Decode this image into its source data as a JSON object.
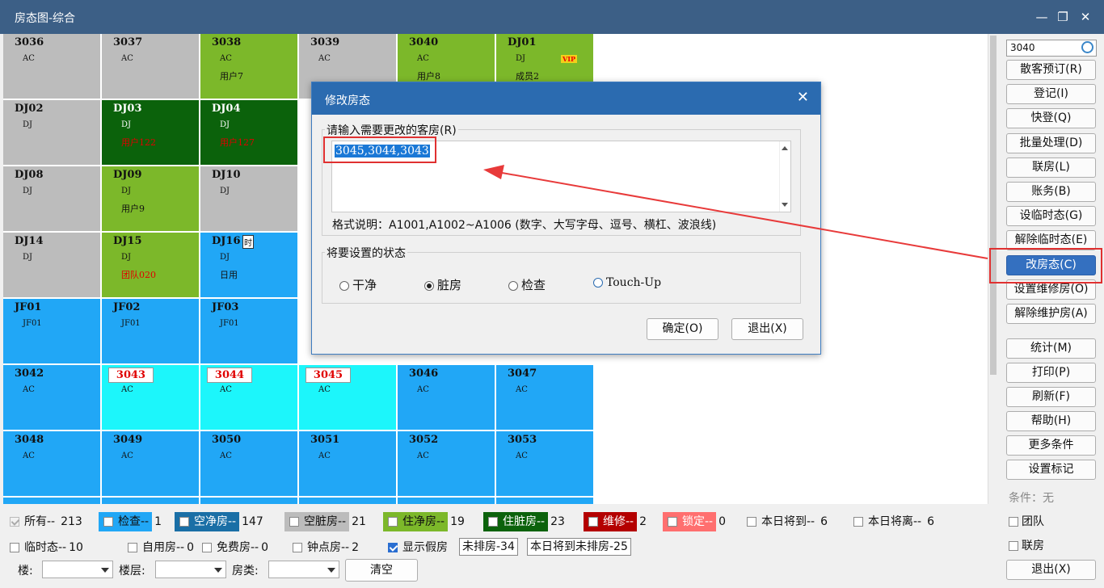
{
  "window": {
    "title": "房态图-综合",
    "min": "—",
    "restore": "❐",
    "close": "✕"
  },
  "rooms": [
    {
      "num": "3036",
      "type": "AC",
      "guest": "",
      "color": "gray"
    },
    {
      "num": "3037",
      "type": "AC",
      "guest": "",
      "color": "gray"
    },
    {
      "num": "3038",
      "type": "AC",
      "guest": "用户7",
      "color": "green"
    },
    {
      "num": "3039",
      "type": "AC",
      "guest": "",
      "color": "gray"
    },
    {
      "num": "3040",
      "type": "AC",
      "guest": "用户8",
      "color": "green"
    },
    {
      "num": "DJ01",
      "type": "DJ",
      "guest": "成员2",
      "color": "green",
      "badge": "VIP"
    },
    {
      "num": "DJ02",
      "type": "DJ",
      "guest": "",
      "color": "gray"
    },
    {
      "num": "DJ03",
      "type": "DJ",
      "guest": "用户122",
      "color": "dgreen",
      "guest_red": true
    },
    {
      "num": "DJ04",
      "type": "DJ",
      "guest": "用户127",
      "color": "dgreen",
      "guest_red": true
    },
    {
      "num": "DJ08",
      "type": "DJ",
      "guest": "",
      "color": "gray"
    },
    {
      "num": "DJ09",
      "type": "DJ",
      "guest": "用户9",
      "color": "green"
    },
    {
      "num": "DJ10",
      "type": "DJ",
      "guest": "",
      "color": "gray"
    },
    {
      "num": "DJ14",
      "type": "DJ",
      "guest": "",
      "color": "gray"
    },
    {
      "num": "DJ15",
      "type": "DJ",
      "guest": "团队020",
      "color": "green",
      "guest_red": true
    },
    {
      "num": "DJ16",
      "type": "DJ",
      "guest": "日用",
      "color": "blue",
      "badge": "时"
    },
    {
      "num": "JF01",
      "type": "JF01",
      "guest": "",
      "color": "blue"
    },
    {
      "num": "JF02",
      "type": "JF01",
      "guest": "",
      "color": "blue"
    },
    {
      "num": "JF03",
      "type": "JF01",
      "guest": "",
      "color": "blue"
    },
    {
      "num": "3042",
      "type": "AC",
      "guest": "",
      "color": "blue"
    },
    {
      "num": "3043",
      "type": "AC",
      "guest": "",
      "color": "cyan",
      "tagged": true
    },
    {
      "num": "3044",
      "type": "AC",
      "guest": "",
      "color": "cyan",
      "tagged": true
    },
    {
      "num": "3045",
      "type": "AC",
      "guest": "",
      "color": "cyan",
      "tagged": true
    },
    {
      "num": "3046",
      "type": "AC",
      "guest": "",
      "color": "blue"
    },
    {
      "num": "3047",
      "type": "AC",
      "guest": "",
      "color": "blue"
    },
    {
      "num": "3048",
      "type": "AC",
      "guest": "",
      "color": "blue"
    },
    {
      "num": "3049",
      "type": "AC",
      "guest": "",
      "color": "blue"
    },
    {
      "num": "3050",
      "type": "AC",
      "guest": "",
      "color": "blue"
    },
    {
      "num": "3051",
      "type": "AC",
      "guest": "",
      "color": "blue"
    },
    {
      "num": "3052",
      "type": "AC",
      "guest": "",
      "color": "blue"
    },
    {
      "num": "3053",
      "type": "AC",
      "guest": "",
      "color": "blue"
    }
  ],
  "sidebar": {
    "search_value": "3040",
    "buttons": [
      "散客预订(R)",
      "登记(I)",
      "快登(Q)",
      "批量处理(D)",
      "联房(L)",
      "账务(B)",
      "设临时态(G)",
      "解除临时态(E)",
      "改房态(C)",
      "设置维修房(O)",
      "解除维护房(A)"
    ],
    "buttons2": [
      "统计(M)",
      "打印(P)",
      "刷新(F)",
      "帮助(H)",
      "更多条件",
      "设置标记"
    ],
    "condition_label": "条件：无",
    "chk_team": "团队",
    "chk_link": "联房",
    "exit": "退出(X)"
  },
  "legend": {
    "row1": [
      {
        "label": "所有--",
        "count": "213",
        "swatch": "",
        "state": "dis"
      },
      {
        "label": "检查--",
        "count": "1",
        "swatch": "blue",
        "state": "off"
      },
      {
        "label": "空净房--",
        "count": "147",
        "swatch": "dblue",
        "state": "off"
      },
      {
        "label": "空脏房--",
        "count": "21",
        "swatch": "gray",
        "state": "off"
      },
      {
        "label": "住净房--",
        "count": "19",
        "swatch": "green",
        "state": "off"
      },
      {
        "label": "住脏房--",
        "count": "23",
        "swatch": "dgreen",
        "state": "off"
      },
      {
        "label": "维修--",
        "count": "2",
        "swatch": "red",
        "state": "off"
      },
      {
        "label": "锁定--",
        "count": "0",
        "swatch": "pink",
        "state": "off"
      },
      {
        "label": "本日将到--",
        "count": "6",
        "swatch": "",
        "state": "off"
      },
      {
        "label": "本日将离--",
        "count": "6",
        "swatch": "",
        "state": "off"
      }
    ],
    "row2": [
      {
        "label": "临时态--",
        "count": "10",
        "state": "off"
      },
      {
        "label": "自用房--",
        "count": "0",
        "state": "off"
      },
      {
        "label": "免费房--",
        "count": "0",
        "state": "off"
      },
      {
        "label": "钟点房--",
        "count": "2",
        "state": "off"
      },
      {
        "label": "显示假房",
        "count": "",
        "state": "on"
      }
    ],
    "unassigned": "未排房-34",
    "arriving_unassigned": "本日将到未排房-25",
    "building_label": "楼:",
    "floor_label": "楼层:",
    "roomtype_label": "房类:",
    "clear": "清空"
  },
  "dialog": {
    "title": "修改房态",
    "close": "✕",
    "input_label": "请输入需要更改的客房(R)",
    "input_value": "3045,3044,3043",
    "hint": "格式说明：A1001,A1002~A1006 (数字、大写字母、逗号、横杠、波浪线)",
    "state_label": "将要设置的状态",
    "options": [
      "干净",
      "脏房",
      "检查",
      "Touch-Up"
    ],
    "selected": "脏房",
    "ok": "确定(O)",
    "cancel": "退出(X)"
  },
  "colors": {
    "gray": "#bcbcbc",
    "green": "#7cb82a",
    "dgreen": "#0b620b",
    "blue": "#21a7f6",
    "cyan": "#1cf6fb",
    "accent": "#3470c0",
    "highlight": "#e03030"
  }
}
